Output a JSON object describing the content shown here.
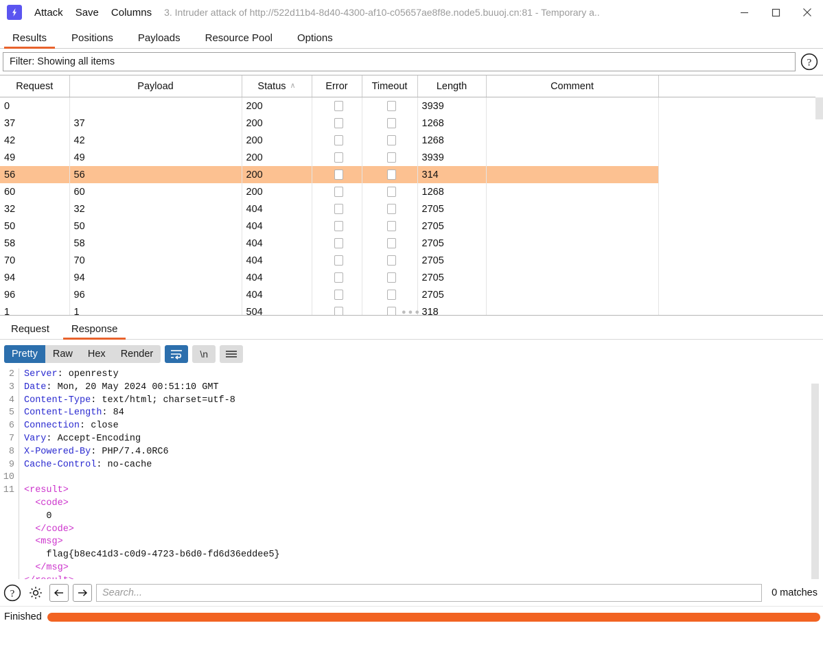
{
  "titlebar": {
    "logo_icon": "burp-lightning-icon",
    "menus": [
      {
        "label": "Attack",
        "name": "menu-attack"
      },
      {
        "label": "Save",
        "name": "menu-save"
      },
      {
        "label": "Columns",
        "name": "menu-columns"
      }
    ],
    "window_title": "3. Intruder attack of http://522d11b4-8d40-4300-af10-c05657ae8f8e.node5.buuoj.cn:81 - Temporary a..",
    "minimize_icon": "minimize-icon",
    "maximize_icon": "maximize-icon",
    "close_icon": "close-icon"
  },
  "tabs": [
    {
      "label": "Results",
      "active": true
    },
    {
      "label": "Positions",
      "active": false
    },
    {
      "label": "Payloads",
      "active": false
    },
    {
      "label": "Resource Pool",
      "active": false
    },
    {
      "label": "Options",
      "active": false
    }
  ],
  "filter": {
    "text": "Filter: Showing all items",
    "help_icon": "help-circle-icon"
  },
  "results_table": {
    "columns": [
      "Request",
      "Payload",
      "Status",
      "Error",
      "Timeout",
      "Length",
      "Comment",
      ""
    ],
    "sort_column": "Status",
    "sort_direction": "ascending",
    "sort_caret": "∧",
    "rows": [
      {
        "request": "0",
        "payload": "",
        "status": "200",
        "error": false,
        "timeout": false,
        "length": "3939",
        "comment": "",
        "selected": false
      },
      {
        "request": "37",
        "payload": "37",
        "status": "200",
        "error": false,
        "timeout": false,
        "length": "1268",
        "comment": "",
        "selected": false
      },
      {
        "request": "42",
        "payload": "42",
        "status": "200",
        "error": false,
        "timeout": false,
        "length": "1268",
        "comment": "",
        "selected": false
      },
      {
        "request": "49",
        "payload": "49",
        "status": "200",
        "error": false,
        "timeout": false,
        "length": "3939",
        "comment": "",
        "selected": false
      },
      {
        "request": "56",
        "payload": "56",
        "status": "200",
        "error": false,
        "timeout": false,
        "length": "314",
        "comment": "",
        "selected": true
      },
      {
        "request": "60",
        "payload": "60",
        "status": "200",
        "error": false,
        "timeout": false,
        "length": "1268",
        "comment": "",
        "selected": false
      },
      {
        "request": "32",
        "payload": "32",
        "status": "404",
        "error": false,
        "timeout": false,
        "length": "2705",
        "comment": "",
        "selected": false
      },
      {
        "request": "50",
        "payload": "50",
        "status": "404",
        "error": false,
        "timeout": false,
        "length": "2705",
        "comment": "",
        "selected": false
      },
      {
        "request": "58",
        "payload": "58",
        "status": "404",
        "error": false,
        "timeout": false,
        "length": "2705",
        "comment": "",
        "selected": false
      },
      {
        "request": "70",
        "payload": "70",
        "status": "404",
        "error": false,
        "timeout": false,
        "length": "2705",
        "comment": "",
        "selected": false
      },
      {
        "request": "94",
        "payload": "94",
        "status": "404",
        "error": false,
        "timeout": false,
        "length": "2705",
        "comment": "",
        "selected": false
      },
      {
        "request": "96",
        "payload": "96",
        "status": "404",
        "error": false,
        "timeout": false,
        "length": "2705",
        "comment": "",
        "selected": false
      },
      {
        "request": "1",
        "payload": "1",
        "status": "504",
        "error": false,
        "timeout": false,
        "length": "318",
        "comment": "",
        "selected": false
      }
    ],
    "selected_row_color": "#fcc191"
  },
  "message_tabs": [
    {
      "label": "Request",
      "active": false
    },
    {
      "label": "Response",
      "active": true
    }
  ],
  "view_toolbar": {
    "modes": [
      {
        "label": "Pretty",
        "active": true
      },
      {
        "label": "Raw",
        "active": false
      },
      {
        "label": "Hex",
        "active": false
      },
      {
        "label": "Render",
        "active": false
      }
    ],
    "wrap_button": {
      "icon": "word-wrap-icon",
      "active": true
    },
    "newline_button": {
      "label": "\\n",
      "icon": "show-newlines-icon",
      "active": false
    },
    "menu_button": {
      "icon": "hamburger-menu-icon",
      "active": false
    }
  },
  "response": {
    "lines": [
      {
        "no": "2",
        "name": "Server",
        "value": " openresty"
      },
      {
        "no": "3",
        "name": "Date",
        "value": " Mon, 20 May 2024 00:51:10 GMT"
      },
      {
        "no": "4",
        "name": "Content-Type",
        "value": " text/html; charset=utf-8"
      },
      {
        "no": "5",
        "name": "Content-Length",
        "value": " 84"
      },
      {
        "no": "6",
        "name": "Connection",
        "value": " close"
      },
      {
        "no": "7",
        "name": "Vary",
        "value": " Accept-Encoding"
      },
      {
        "no": "8",
        "name": "X-Powered-By",
        "value": " PHP/7.4.0RC6"
      },
      {
        "no": "9",
        "name": "Cache-Control",
        "value": " no-cache"
      },
      {
        "no": "10",
        "name": "",
        "value": ""
      }
    ],
    "body": [
      {
        "no": "11",
        "indent": "",
        "tag": "<result>",
        "text": ""
      },
      {
        "no": "",
        "indent": "  ",
        "tag": "<code>",
        "text": ""
      },
      {
        "no": "",
        "indent": "    ",
        "tag": "",
        "text": "0"
      },
      {
        "no": "",
        "indent": "  ",
        "tag": "</code>",
        "text": ""
      },
      {
        "no": "",
        "indent": "  ",
        "tag": "<msg>",
        "text": ""
      },
      {
        "no": "",
        "indent": "    ",
        "tag": "",
        "text": "flag{b8ec41d3-c0d9-4723-b6d0-fd6d36eddee5}"
      },
      {
        "no": "",
        "indent": "  ",
        "tag": "</msg>",
        "text": ""
      },
      {
        "no": "",
        "indent": "",
        "tag": "</result>",
        "text": ""
      }
    ]
  },
  "search_footer": {
    "help_icon": "help-circle-icon",
    "settings_icon": "gear-icon",
    "prev_icon": "arrow-left-icon",
    "next_icon": "arrow-right-icon",
    "placeholder": "Search...",
    "value": "",
    "matches": "0 matches"
  },
  "statusbar": {
    "status": "Finished",
    "progress_percent": 100,
    "progress_color": "#f26322"
  }
}
